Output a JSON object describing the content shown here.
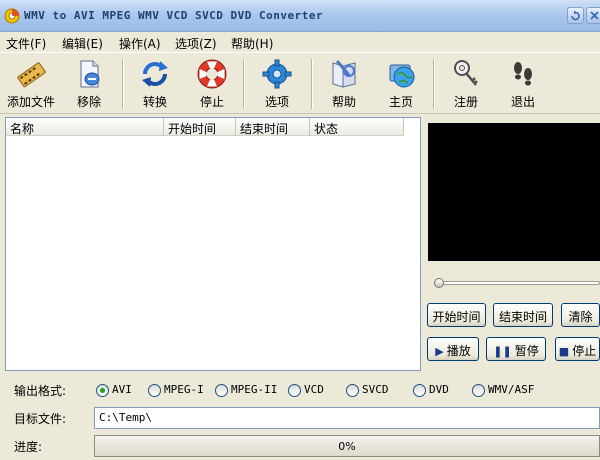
{
  "window": {
    "title": "WMV to AVI MPEG WMV VCD SVCD DVD Converter"
  },
  "menu": [
    "文件(F)",
    "编辑(E)",
    "操作(A)",
    "选项(Z)",
    "帮助(H)"
  ],
  "toolbar": {
    "add_file": "添加文件",
    "remove": "移除",
    "convert": "转换",
    "stop": "停止",
    "options": "选项",
    "help": "帮助",
    "homepage": "主页",
    "register": "注册",
    "exit": "退出"
  },
  "file_list": {
    "columns": [
      "名称",
      "开始时间",
      "结束时间",
      "状态"
    ],
    "rows": []
  },
  "preview": {
    "seek_position": 0
  },
  "controls": {
    "start_time": "开始时间",
    "end_time": "结束时间",
    "clear": "清除",
    "play": "播放",
    "pause": "暂停",
    "stop": "停止"
  },
  "output": {
    "format_label": "输出格式:",
    "formats": [
      "AVI",
      "MPEG-I",
      "MPEG-II",
      "VCD",
      "SVCD",
      "DVD",
      "WMV/ASF"
    ],
    "selected_format": "AVI",
    "target_label": "目标文件:",
    "target_value": "C:\\Temp\\",
    "progress_label": "进度:",
    "progress_percent": 0,
    "progress_text": "0%"
  }
}
